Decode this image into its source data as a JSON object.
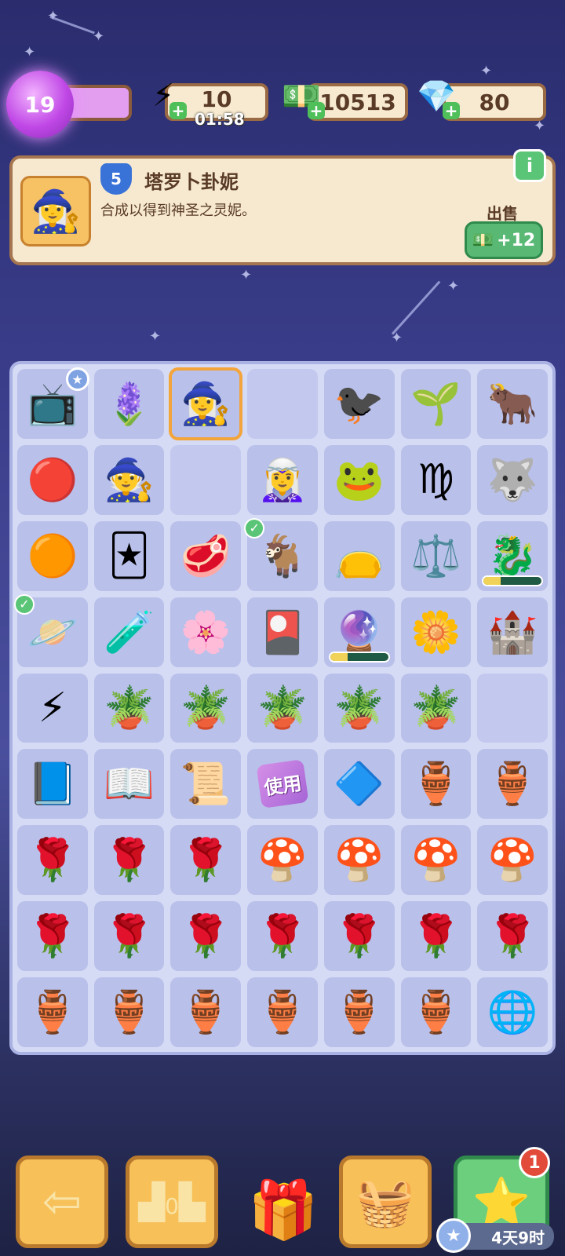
{
  "player": {
    "level": "19"
  },
  "resources": {
    "energy": {
      "value": "10",
      "timer": "01:58",
      "icon": "lightning-icon"
    },
    "cash": {
      "value": "10513",
      "icon": "cash-icon"
    },
    "gems": {
      "value": "80",
      "icon": "ruby-icon"
    }
  },
  "info": {
    "level": "5",
    "title": "塔罗卜卦妮",
    "description": "合成以得到神圣之灵妮。",
    "sell_label": "出售",
    "sell_value": "+12",
    "info_button": "i"
  },
  "board": {
    "cells": [
      {
        "icon": "📺",
        "name": "tv-item",
        "badge": "★"
      },
      {
        "icon": "🪻",
        "name": "magic-flower-item"
      },
      {
        "icon": "🧙‍♀️",
        "name": "tarot-girl-item",
        "selected": true
      },
      {
        "icon": "",
        "name": "empty-cell"
      },
      {
        "icon": "🐦‍⬛",
        "name": "raven-item"
      },
      {
        "icon": "🌱",
        "name": "sprout-item"
      },
      {
        "icon": "🐂",
        "name": "taurus-item"
      },
      {
        "icon": "🔴",
        "name": "red-planet-item"
      },
      {
        "icon": "🧙",
        "name": "wizard-girl-item"
      },
      {
        "icon": "",
        "name": "empty-cell"
      },
      {
        "icon": "🧝‍♀️",
        "name": "mage-item"
      },
      {
        "icon": "🐸",
        "name": "toad-item"
      },
      {
        "icon": "♍",
        "name": "virgo-item"
      },
      {
        "icon": "🐺",
        "name": "wolf-item"
      },
      {
        "icon": "🟠",
        "name": "orange-planet-item"
      },
      {
        "icon": "🃏",
        "name": "tarot-card-item"
      },
      {
        "icon": "🥩",
        "name": "meat-item"
      },
      {
        "icon": "🐐",
        "name": "ram-item",
        "check": true
      },
      {
        "icon": "👝",
        "name": "bag-item"
      },
      {
        "icon": "⚖️",
        "name": "libra-item"
      },
      {
        "icon": "🐉",
        "name": "dragon-item",
        "progress": 0.3
      },
      {
        "icon": "🪐",
        "name": "yellow-planet-item",
        "check": true
      },
      {
        "icon": "🧪",
        "name": "potion-tube-item"
      },
      {
        "icon": "🌸",
        "name": "flower-orb-item"
      },
      {
        "icon": "🎴",
        "name": "card-deck-item"
      },
      {
        "icon": "🔮",
        "name": "crystal-pendulum-item",
        "progress": 0.3
      },
      {
        "icon": "🌼",
        "name": "flower-bush-item"
      },
      {
        "icon": "🏰",
        "name": "haunted-house-item"
      },
      {
        "icon": "⚡",
        "name": "energy-orb-item"
      },
      {
        "icon": "🪴",
        "name": "pot-item"
      },
      {
        "icon": "🪴",
        "name": "pot-item"
      },
      {
        "icon": "🪴",
        "name": "pot-item"
      },
      {
        "icon": "🪴",
        "name": "pot-item"
      },
      {
        "icon": "🪴",
        "name": "pot-item"
      },
      {
        "icon": "",
        "name": "empty-cell"
      },
      {
        "icon": "📘",
        "name": "eye-book-item"
      },
      {
        "icon": "📖",
        "name": "moon-book-item"
      },
      {
        "icon": "📜",
        "name": "spell-book-item"
      },
      {
        "icon": "",
        "name": "use-item",
        "use": "使用"
      },
      {
        "icon": "🔷",
        "name": "rune-item"
      },
      {
        "icon": "🏺",
        "name": "rose-jar-item"
      },
      {
        "icon": "🏺",
        "name": "rose-jar-item"
      },
      {
        "icon": "🌹",
        "name": "rose-potion-item"
      },
      {
        "icon": "🌹",
        "name": "rose-potion-item"
      },
      {
        "icon": "🌹",
        "name": "rose-potion-item"
      },
      {
        "icon": "🍄",
        "name": "gnome-item"
      },
      {
        "icon": "🍄",
        "name": "gnome-item"
      },
      {
        "icon": "🍄",
        "name": "gnome-item"
      },
      {
        "icon": "🍄",
        "name": "gnome-item"
      },
      {
        "icon": "🌹",
        "name": "rose-potion-item"
      },
      {
        "icon": "🌹",
        "name": "rose-potion-item"
      },
      {
        "icon": "🌹",
        "name": "rose-potion-item"
      },
      {
        "icon": "🌹",
        "name": "rose-potion-item"
      },
      {
        "icon": "🌹",
        "name": "rose-potion-item"
      },
      {
        "icon": "🌹",
        "name": "rose-potion-item"
      },
      {
        "icon": "🌹",
        "name": "rose-potion-item"
      },
      {
        "icon": "🏺",
        "name": "rose-jar-item"
      },
      {
        "icon": "🏺",
        "name": "rose-jar-item"
      },
      {
        "icon": "🏺",
        "name": "rose-jar-item"
      },
      {
        "icon": "🏺",
        "name": "rose-jar-item"
      },
      {
        "icon": "🏺",
        "name": "rose-jar-item"
      },
      {
        "icon": "🏺",
        "name": "rose-jar-item"
      },
      {
        "icon": "🌐",
        "name": "globe-item"
      }
    ]
  },
  "bottom": {
    "back_icon": "back-arrow-icon",
    "leaderboard_icon": "podium-icon",
    "leaderboard_text": "0",
    "chest_icon": "gem-chest-icon",
    "basket_icon": "basket-icon",
    "event_icon": "star-icon",
    "event_badge": "1",
    "event_timer": "4天9时"
  },
  "colors": {
    "accent_gold": "#f7c059",
    "accent_green": "#58b874",
    "board_bg": "#d6dbf5"
  }
}
